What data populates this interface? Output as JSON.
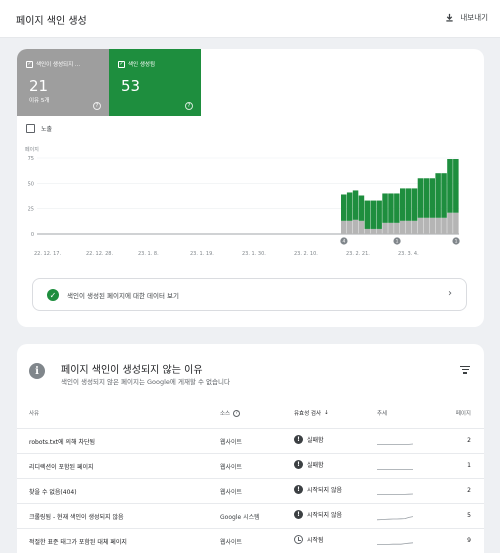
{
  "header": {
    "title": "페이지 색인 생성",
    "export_label": "내보내기"
  },
  "summary": {
    "not_indexed": {
      "label": "색인이 생성되지 ...",
      "value": "21",
      "sub": "이유 5개",
      "color": "#9e9e9e"
    },
    "indexed": {
      "label": "색인 생성됨",
      "value": "53",
      "color": "#1e8e3e"
    }
  },
  "impressions_label": "노출",
  "chart_data": {
    "type": "bar",
    "title": "",
    "ylabel": "페이지",
    "ylim": [
      0,
      75
    ],
    "yticks": [
      "75",
      "50",
      "25",
      "0"
    ],
    "xticks": [
      "22. 12. 17.",
      "22. 12. 28.",
      "23. 1. 8.",
      "23. 1. 19.",
      "23. 1. 30.",
      "23. 2. 10.",
      "23. 2. 21.",
      "23. 3. 4."
    ],
    "categories": [
      "d1",
      "d2",
      "d3",
      "d4",
      "d5",
      "d6",
      "d7",
      "d8",
      "d9",
      "d10",
      "d11",
      "d12",
      "d13",
      "d14",
      "d15",
      "d16",
      "d17",
      "d18",
      "d19",
      "d20"
    ],
    "series": [
      {
        "name": "색인이 생성되지 않음",
        "color": "#b5b5b5",
        "values": [
          13,
          13,
          14,
          13,
          5,
          5,
          5,
          11,
          11,
          11,
          13,
          13,
          13,
          16,
          16,
          16,
          16,
          16,
          21,
          21
        ]
      },
      {
        "name": "색인 생성됨",
        "color": "#1e8e3e",
        "values": [
          26,
          28,
          29,
          25,
          28,
          28,
          28,
          29,
          29,
          29,
          32,
          32,
          32,
          39,
          39,
          39,
          44,
          44,
          53,
          53
        ]
      }
    ],
    "annotations": [
      {
        "label": "4",
        "at": "d1"
      },
      {
        "label": "1",
        "at": "d10"
      },
      {
        "label": "1",
        "at": "d20"
      }
    ]
  },
  "view_data_label": "색인이 생성된 페이지에 대한 데이터 보기",
  "reasons": {
    "title": "페이지 색인이 생성되지 않는 이유",
    "subtitle": "색인이 생성되지 않은 페이지는 Google에 게재할 수 없습니다",
    "columns": {
      "reason": "사유",
      "source": "소스",
      "validation": "유효성 검사",
      "trend": "추세",
      "pages": "페이지"
    },
    "rows": [
      {
        "reason": "robots.txt에 의해 차단됨",
        "source": "웹사이트",
        "validation": "실패함",
        "status": "fail",
        "pages": "2",
        "trend": [
          0.2,
          0.2,
          0.2,
          0.2,
          0.2,
          0.2,
          0.2,
          0.2,
          0.2,
          0.25
        ]
      },
      {
        "reason": "리디렉션이 포함된 페이지",
        "source": "웹사이트",
        "validation": "실패함",
        "status": "fail",
        "pages": "1",
        "trend": [
          0.2,
          0.2,
          0.2,
          0.2,
          0.2,
          0.2,
          0.2,
          0.2,
          0.2,
          0.2
        ]
      },
      {
        "reason": "찾을 수 없음(404)",
        "source": "웹사이트",
        "validation": "시작되지 않음",
        "status": "fail",
        "pages": "2",
        "trend": [
          0.2,
          0.2,
          0.2,
          0.2,
          0.2,
          0.2,
          0.2,
          0.2,
          0.22,
          0.25
        ]
      },
      {
        "reason": "크롤링됨 - 현재 색인이 생성되지 않음",
        "source": "Google 시스템",
        "validation": "시작되지 않음",
        "status": "fail",
        "pages": "5",
        "trend": [
          0.15,
          0.18,
          0.2,
          0.22,
          0.25,
          0.25,
          0.28,
          0.3,
          0.45,
          0.55
        ]
      },
      {
        "reason": "적절한 표준 태그가 포함된 대체 페이지",
        "source": "웹사이트",
        "validation": "시작됨",
        "status": "pending",
        "pages": "9",
        "trend": [
          0.2,
          0.2,
          0.2,
          0.2,
          0.22,
          0.22,
          0.22,
          0.3,
          0.35,
          0.4
        ]
      }
    ]
  }
}
